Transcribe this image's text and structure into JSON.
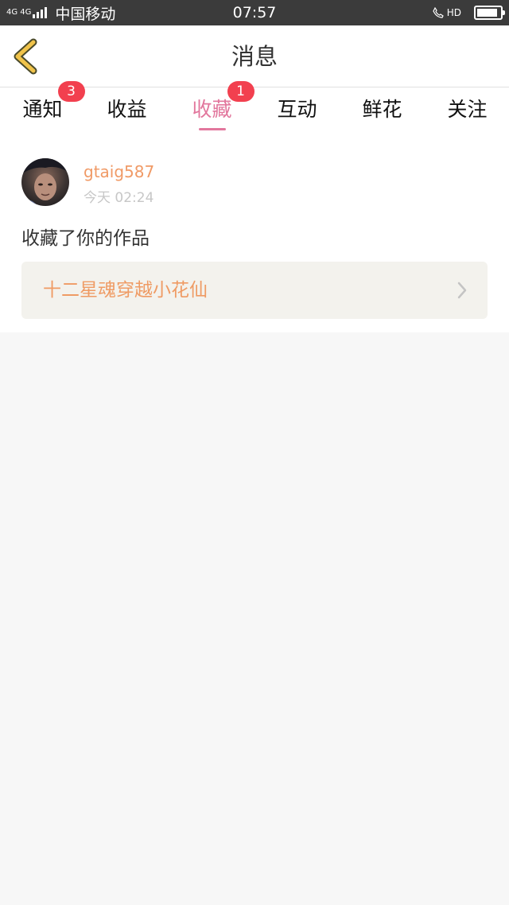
{
  "status_bar": {
    "network": "4G 4G",
    "carrier": "中国移动",
    "time": "07:57",
    "call_label": "HD",
    "battery_level": 0.9
  },
  "nav": {
    "title": "消息",
    "back_icon": "chevron-left-icon",
    "accent_color": "#f0c34a"
  },
  "tabs": [
    {
      "label": "通知",
      "badge": "3"
    },
    {
      "label": "收益",
      "badge": ""
    },
    {
      "label": "收藏",
      "badge": "1",
      "active": true
    },
    {
      "label": "互动",
      "badge": ""
    },
    {
      "label": "鲜花",
      "badge": ""
    },
    {
      "label": "关注",
      "badge": ""
    }
  ],
  "active_color": "#e2779d",
  "badge_color": "#f2404f",
  "message": {
    "username": "gtaig587",
    "time": "今天 02:24",
    "action": "收藏了你的作品",
    "work_title": "十二星魂穿越小花仙",
    "link_icon": "chevron-right-icon"
  }
}
